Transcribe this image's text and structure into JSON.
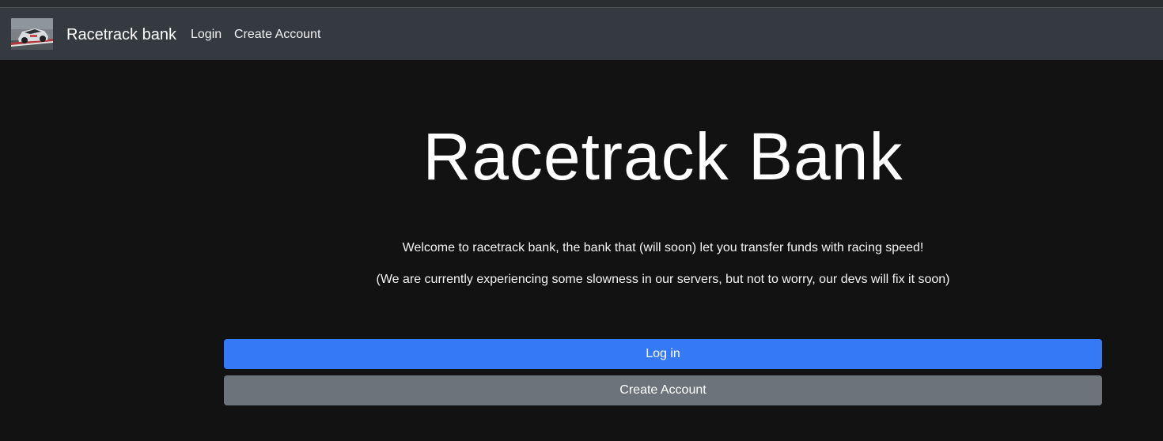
{
  "navbar": {
    "brand": "Racetrack bank",
    "links": [
      {
        "label": "Login"
      },
      {
        "label": "Create Account"
      }
    ],
    "logo_icon": "race-car-photo-logo"
  },
  "hero": {
    "title": "Racetrack Bank",
    "paragraphs": [
      "Welcome to racetrack bank, the bank that (will soon) let you transfer funds with racing speed!",
      "(We are currently experiencing some slowness in our servers, but not to worry, our devs will fix it soon)"
    ]
  },
  "actions": {
    "login_label": "Log in",
    "create_account_label": "Create Account"
  },
  "colors": {
    "page_background": "#121212",
    "navbar_background": "#343a40",
    "primary_button": "#3579f6",
    "secondary_button": "#6c737a"
  }
}
